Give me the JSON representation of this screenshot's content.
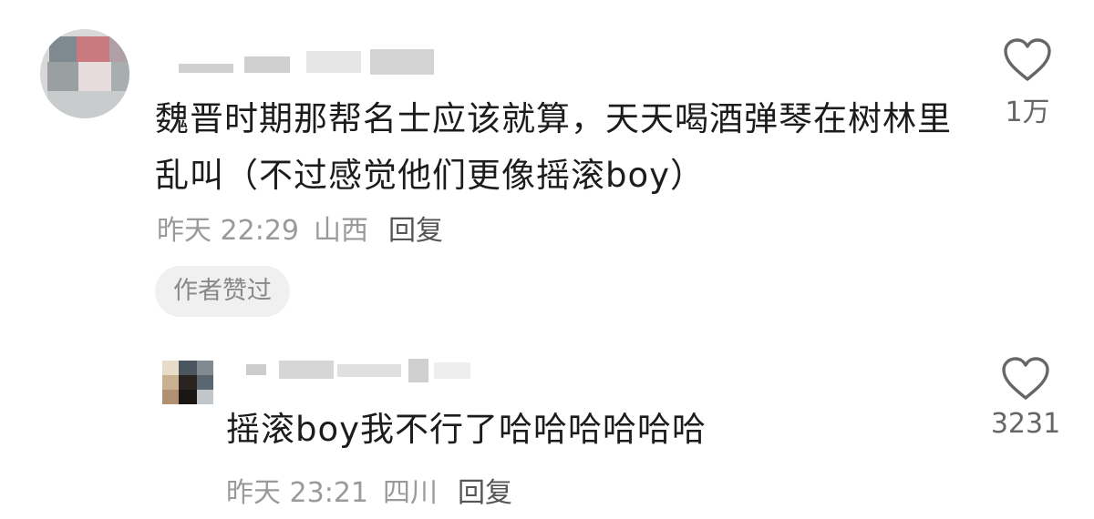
{
  "comments": [
    {
      "text": "魏晋时期那帮名士应该就算，天天喝酒弹琴在树林里乱叫（不过感觉他们更像摇滚boy）",
      "time": "昨天 22:29",
      "location": "山西",
      "reply_label": "回复",
      "badge": "作者赞过",
      "likes": "1万",
      "icons": {
        "avatar": "avatar",
        "like": "heart-icon"
      }
    },
    {
      "text": "摇滚boy我不行了哈哈哈哈哈哈",
      "time": "昨天 23:21",
      "location": "四川",
      "reply_label": "回复",
      "likes": "3231",
      "icons": {
        "avatar": "avatar",
        "like": "heart-icon"
      }
    }
  ],
  "colors": {
    "text": "#1c1c1c",
    "meta": "#9a9a9a",
    "badge_bg": "#f0f0f0"
  }
}
